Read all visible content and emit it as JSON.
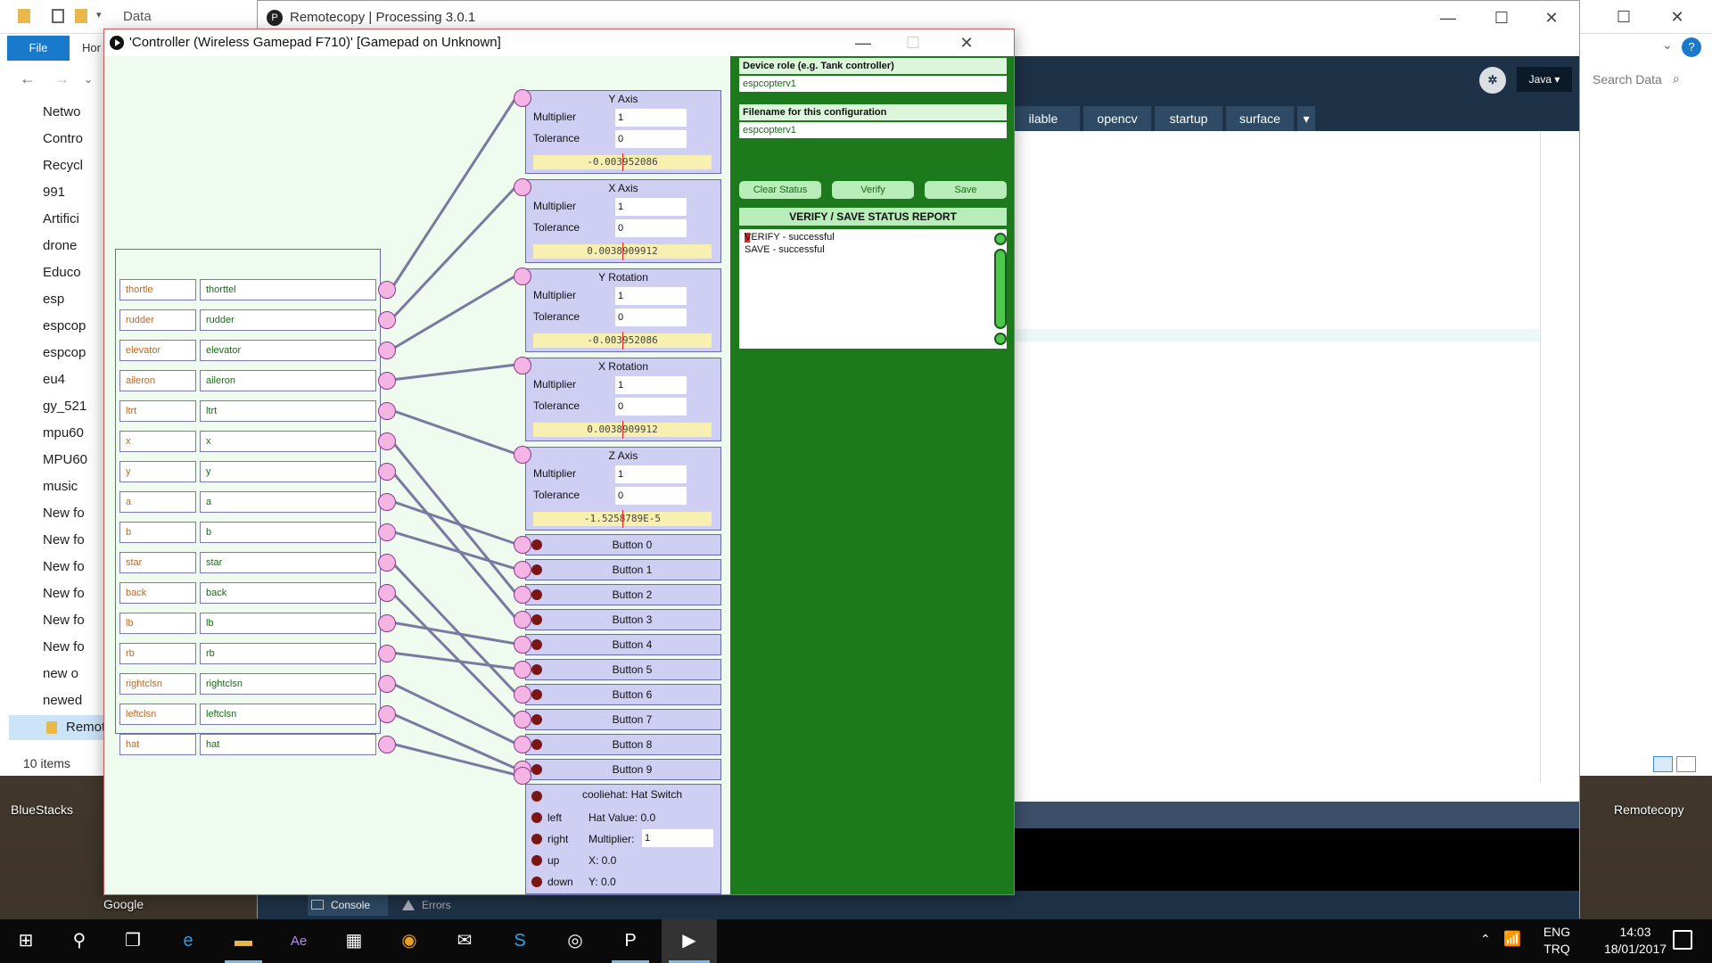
{
  "desktop": {
    "icons": [
      {
        "label": "Google"
      },
      {
        "label": "BlueStacks"
      },
      {
        "label": "Remotecopy"
      }
    ]
  },
  "explorer": {
    "title": "Data",
    "file_tab": "File",
    "home_tab": "Hor",
    "tree": [
      "Netwo",
      "Contro",
      "Recycl",
      "991",
      "Artifici",
      "drone",
      "Educo",
      "esp",
      "espcop",
      "espcop",
      "eu4",
      "gy_521",
      "mpu60",
      "MPU60",
      "music",
      "New fo",
      "New fo",
      "New fo",
      "New fo",
      "New fo",
      "New fo",
      "new o",
      "newed",
      "Remot"
    ],
    "status": "10 items",
    "search_placeholder": "Search Data"
  },
  "ide": {
    "title": "Remotecopy | Processing 3.0.1",
    "mode": "Java ▾",
    "tabs": [
      "ilable",
      "opencv",
      "startup",
      "surface",
      "▾"
    ],
    "console_tab": "Console",
    "errors_tab": "Errors"
  },
  "controller": {
    "title": "'Controller (Wireless Gamepad F710)'  [Gamepad on Unknown]",
    "inputs": [
      {
        "name": "thortle",
        "alias": "thorttel"
      },
      {
        "name": "rudder",
        "alias": "rudder"
      },
      {
        "name": "elevator",
        "alias": "elevator"
      },
      {
        "name": "aileron",
        "alias": "aileron"
      },
      {
        "name": "ltrt",
        "alias": "ltrt"
      },
      {
        "name": "x",
        "alias": "x"
      },
      {
        "name": "y",
        "alias": "y"
      },
      {
        "name": "a",
        "alias": "a"
      },
      {
        "name": "b",
        "alias": "b"
      },
      {
        "name": "star",
        "alias": "star"
      },
      {
        "name": "back",
        "alias": "back"
      },
      {
        "name": "lb",
        "alias": "lb"
      },
      {
        "name": "rb",
        "alias": "rb"
      },
      {
        "name": "rightclsn",
        "alias": "rightclsn"
      },
      {
        "name": "leftclsn",
        "alias": "leftclsn"
      },
      {
        "name": "hat",
        "alias": "hat"
      }
    ],
    "axes": [
      {
        "title": "Y Axis",
        "multiplier": "1",
        "tolerance": "0",
        "value": "-0.003952086"
      },
      {
        "title": "X Axis",
        "multiplier": "1",
        "tolerance": "0",
        "value": "0.0038909912"
      },
      {
        "title": "Y Rotation",
        "multiplier": "1",
        "tolerance": "0",
        "value": "-0.003952086"
      },
      {
        "title": "X Rotation",
        "multiplier": "1",
        "tolerance": "0",
        "value": "0.0038909912"
      },
      {
        "title": "Z Axis",
        "multiplier": "1",
        "tolerance": "0",
        "value": "-1.5258789E-5"
      }
    ],
    "axis_labels": {
      "multiplier": "Multiplier",
      "tolerance": "Tolerance"
    },
    "buttons": [
      "Button 0",
      "Button 1",
      "Button 2",
      "Button 3",
      "Button 4",
      "Button 5",
      "Button 6",
      "Button 7",
      "Button 8",
      "Button 9"
    ],
    "hat": {
      "title": "cooliehat: Hat Switch",
      "directions": [
        "left",
        "right",
        "up",
        "down"
      ],
      "hat_value": "Hat Value:  0.0",
      "multiplier_label": "Multiplier:",
      "multiplier": "1",
      "x": "X:   0.0",
      "y": "Y:   0.0"
    },
    "config": {
      "role_label": "Device role (e.g. Tank controller)",
      "role_value": "espcopterv1",
      "filename_label": "Filename for this configuration",
      "filename_value": "espcopterv1",
      "clear_label": "Clear Status",
      "verify_label": "Verify",
      "save_label": "Save",
      "report_title": "VERIFY / SAVE STATUS REPORT",
      "report_first_char": "V",
      "report_line1_rest": "ERIFY - successful",
      "report_line2": "SAVE - successful"
    },
    "colors": {
      "config_bg": "#1c7a1c",
      "panel_bg": "#cfcff4",
      "canvas_bg": "#eefbee",
      "port": "#f4b4e4",
      "wire": "#7a7aa0"
    }
  },
  "taskbar": {
    "lang": "ENG",
    "kbd": "TRQ",
    "time": "14:03",
    "date": "18/01/2017"
  }
}
